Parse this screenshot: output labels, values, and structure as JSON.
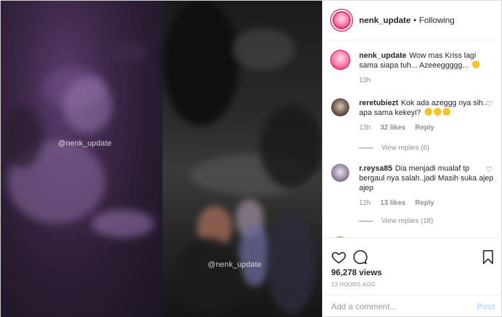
{
  "media": {
    "watermark_left": "@nenk_update",
    "watermark_right": "@nenk_update"
  },
  "header": {
    "username": "nenk_update",
    "separator": "•",
    "follow_status": "Following"
  },
  "caption": {
    "username": "nenk_update",
    "text": "Wow mas Kriss lagi sama siapa tuh... Azeeeggggg...",
    "time": "13h"
  },
  "comments": [
    {
      "username": "reretubiezt",
      "text": "Kok ada azeggg nya sih.. apa sama kekeyi?",
      "time": "13h",
      "likes": "32 likes",
      "reply": "Reply",
      "view_replies": "View replies (6)"
    },
    {
      "username": "r.reysa85",
      "text": "Dia menjadi mualaf tp bergaul nya salah..jadi Masih suka ajep ajep",
      "time": "12h",
      "likes": "13 likes",
      "reply": "Reply",
      "view_replies": "View replies (18)"
    }
  ],
  "actions": {
    "views": "96,278 views",
    "time_ago": "13 HOURS AGO"
  },
  "add_comment": {
    "placeholder": "Add a comment...",
    "post_label": "Post"
  },
  "colors": {
    "accent": "#e1306c",
    "post_disabled": "#b2dffc",
    "meta_text": "#8e8e8e"
  }
}
